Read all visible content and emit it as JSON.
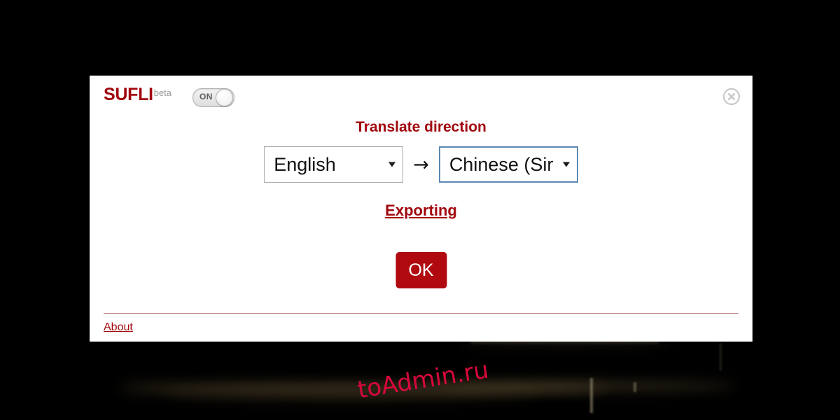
{
  "dialog": {
    "brand": {
      "name": "SUFLI",
      "beta_label": "beta"
    },
    "toggle": {
      "state_label": "ON"
    },
    "close_icon": "close-circle-icon",
    "heading": "Translate direction",
    "direction": {
      "source_value": "English",
      "target_value": "Chinese (Sir",
      "arrow_glyph": "→",
      "dropdown_icon": "chevron-down-icon"
    },
    "status": {
      "text": "Exporting"
    },
    "confirm_button": {
      "label": "OK"
    },
    "footer": {
      "about_label": "About"
    }
  },
  "watermark": {
    "text": "toAdmin.ru"
  },
  "colors": {
    "brand_red": "#a1070d",
    "button_red": "#b00a10",
    "focus_blue": "#5b89b5",
    "watermark_red": "#d6083b",
    "backdrop": "#000000",
    "panel": "#ffffff"
  }
}
